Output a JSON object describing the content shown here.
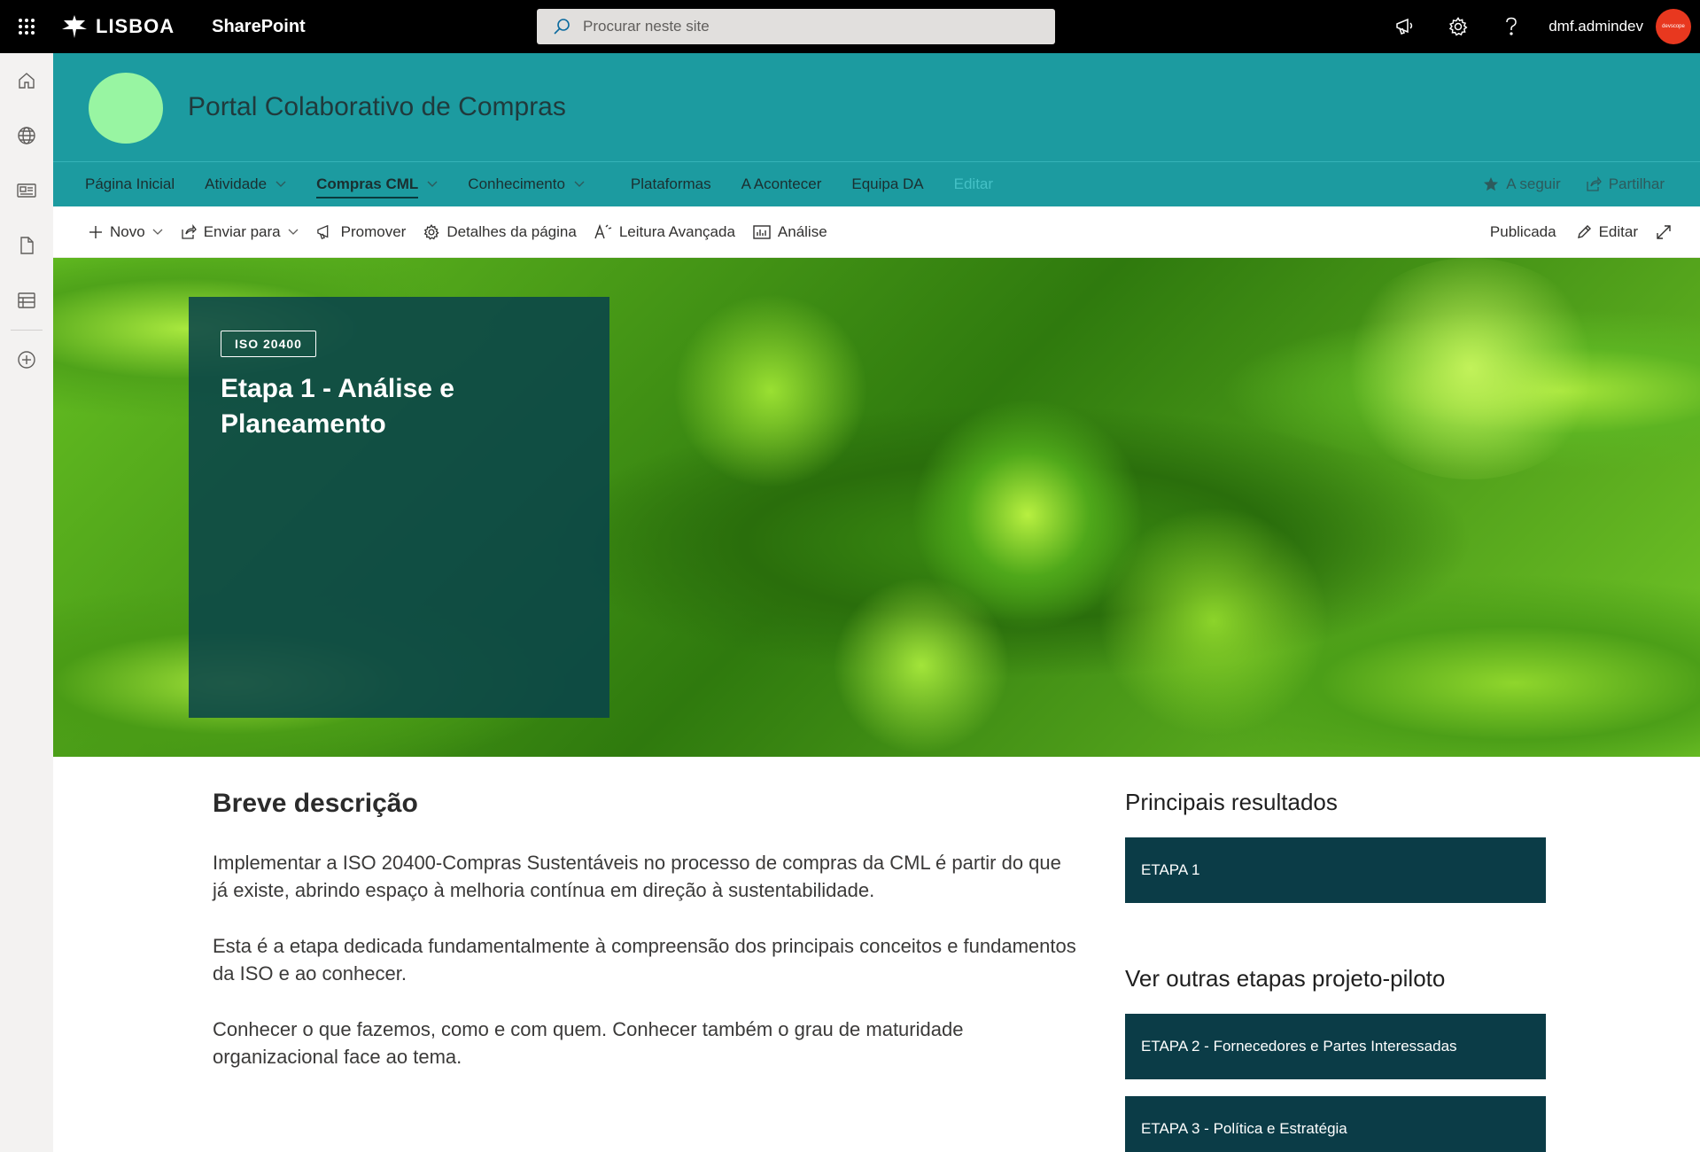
{
  "suitebar": {
    "brand": "LISBOA",
    "app": "SharePoint",
    "search_placeholder": "Procurar neste site",
    "user": "dmf.admindev",
    "avatar_text": "devscope"
  },
  "site": {
    "title": "Portal Colaborativo de Compras"
  },
  "nav": {
    "items": [
      {
        "label": "Página Inicial"
      },
      {
        "label": "Atividade"
      },
      {
        "label": "Compras CML"
      },
      {
        "label": "Conhecimento"
      },
      {
        "label": "Plataformas"
      },
      {
        "label": "A Acontecer"
      },
      {
        "label": "Equipa DA"
      },
      {
        "label": "Editar"
      }
    ],
    "follow": "A seguir",
    "share": "Partilhar"
  },
  "commands": {
    "new": "Novo",
    "send": "Enviar para",
    "promote": "Promover",
    "page_details": "Detalhes da página",
    "immersive": "Leitura Avançada",
    "analytics": "Análise",
    "status": "Publicada",
    "edit": "Editar"
  },
  "hero": {
    "tag": "ISO 20400",
    "title": "Etapa 1 - Análise e Planeamento"
  },
  "content": {
    "heading": "Breve descrição",
    "paragraphs": [
      "Implementar a ISO 20400-Compras Sustentáveis no processo de compras da CML é partir do que já existe, abrindo espaço à melhoria contínua em direção à sustentabilidade.",
      "Esta é a etapa dedicada fundamentalmente à compreensão dos principais conceitos e fundamentos da ISO e ao conhecer.",
      "Conhecer o que fazemos, como e com quem. Conhecer também o grau de maturidade organizacional face ao tema."
    ]
  },
  "sidebar": {
    "results_heading": "Principais resultados",
    "results": [
      "ETAPA 1"
    ],
    "others_heading": "Ver outras etapas projeto-piloto",
    "others": [
      "ETAPA 2 - Fornecedores e Partes Interessadas",
      "ETAPA 3 - Política e Estratégia"
    ]
  },
  "colors": {
    "site_header": "#1c9ba0",
    "hero_card": "#08424a",
    "button_dark": "#0b3c47",
    "avatar": "#e8381f"
  }
}
